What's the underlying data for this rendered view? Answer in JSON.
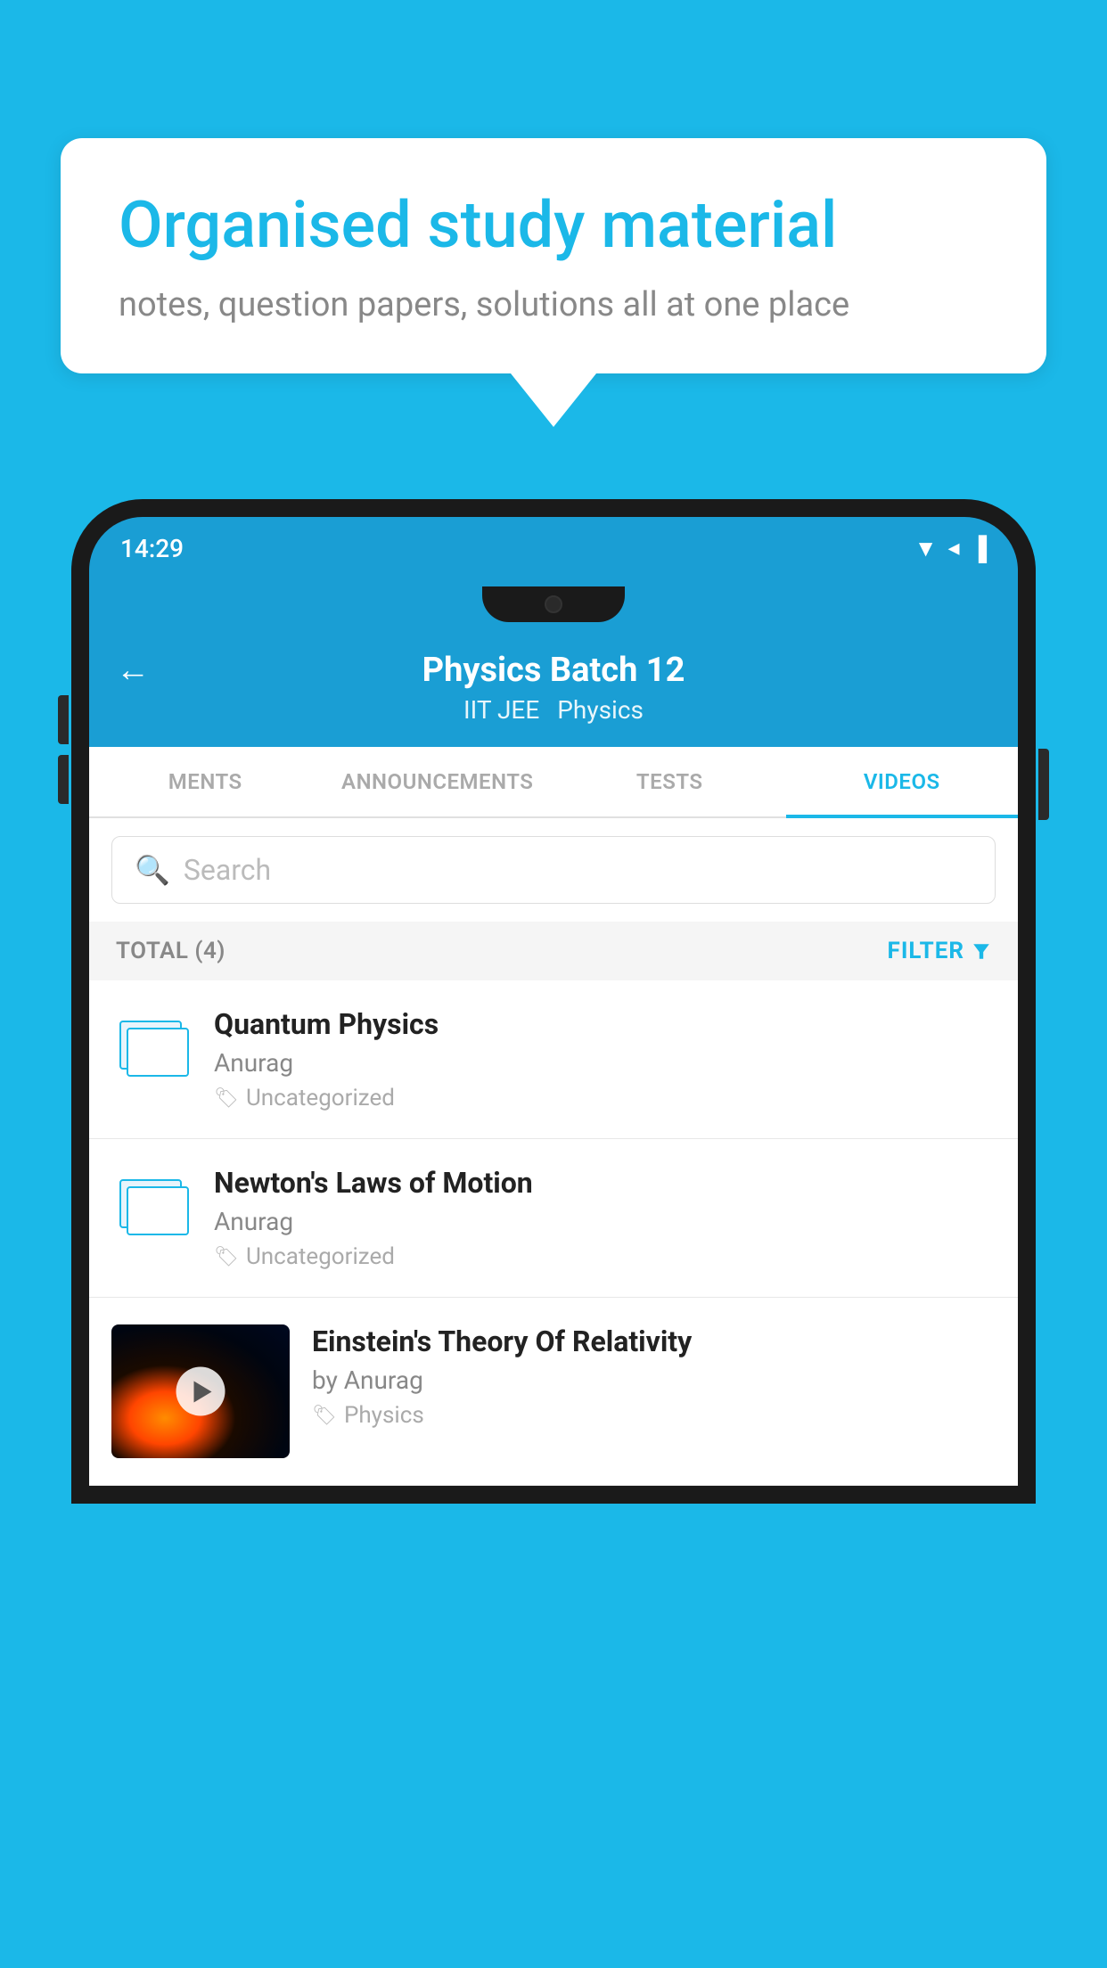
{
  "bubble": {
    "heading": "Organised study material",
    "subtext": "notes, question papers, solutions all at one place"
  },
  "status_bar": {
    "time": "14:29",
    "signal_icons": "▼ ◂ ▐"
  },
  "header": {
    "back_label": "←",
    "title": "Physics Batch 12",
    "subtitle1": "IIT JEE",
    "subtitle2": "Physics"
  },
  "tabs": [
    {
      "label": "MENTS",
      "active": false
    },
    {
      "label": "ANNOUNCEMENTS",
      "active": false
    },
    {
      "label": "TESTS",
      "active": false
    },
    {
      "label": "VIDEOS",
      "active": true
    }
  ],
  "search": {
    "placeholder": "Search"
  },
  "filter_row": {
    "total_label": "TOTAL (4)",
    "filter_label": "FILTER"
  },
  "videos": [
    {
      "id": 1,
      "title": "Quantum Physics",
      "author": "Anurag",
      "tag": "Uncategorized",
      "has_thumbnail": false
    },
    {
      "id": 2,
      "title": "Newton's Laws of Motion",
      "author": "Anurag",
      "tag": "Uncategorized",
      "has_thumbnail": false
    },
    {
      "id": 3,
      "title": "Einstein's Theory Of Relativity",
      "author": "by Anurag",
      "tag": "Physics",
      "has_thumbnail": true
    }
  ],
  "colors": {
    "brand_blue": "#1BB8E8",
    "dark_text": "#222222",
    "light_text": "#888888"
  }
}
